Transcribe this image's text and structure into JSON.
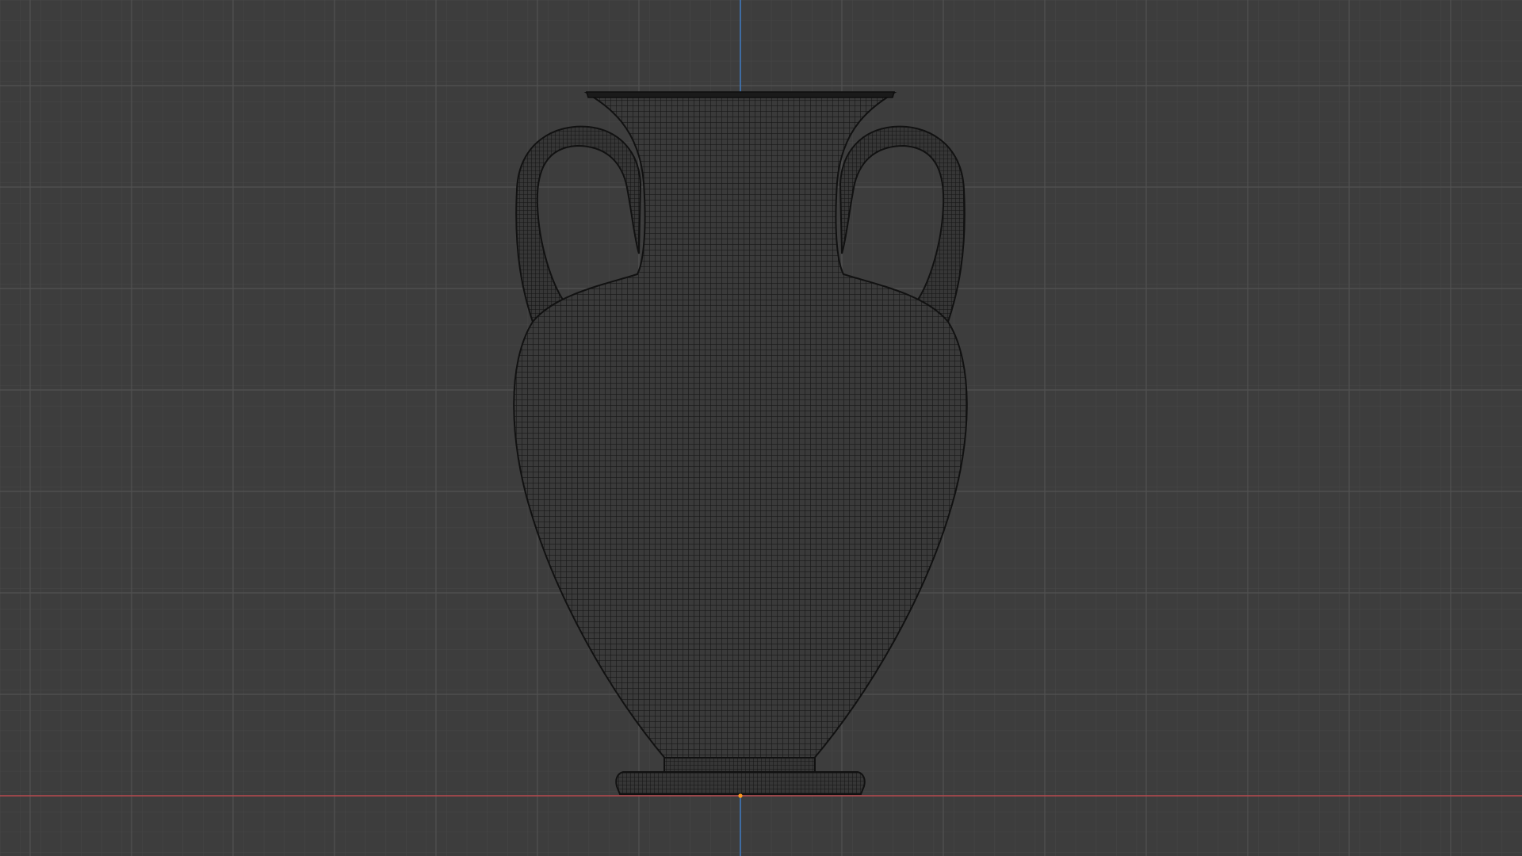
{
  "viewport": {
    "view": "front-orthographic",
    "shading": "wireframe",
    "colors": {
      "background": "#3d3d3d",
      "grid_minor": "#474747",
      "grid_major": "#515151",
      "x_axis": "#b5494e",
      "z_axis": "#3f7bc2",
      "wire": "#181818",
      "origin": "#ff9a1f"
    },
    "objects": [
      {
        "name": "amphora",
        "selected": false
      }
    ]
  }
}
